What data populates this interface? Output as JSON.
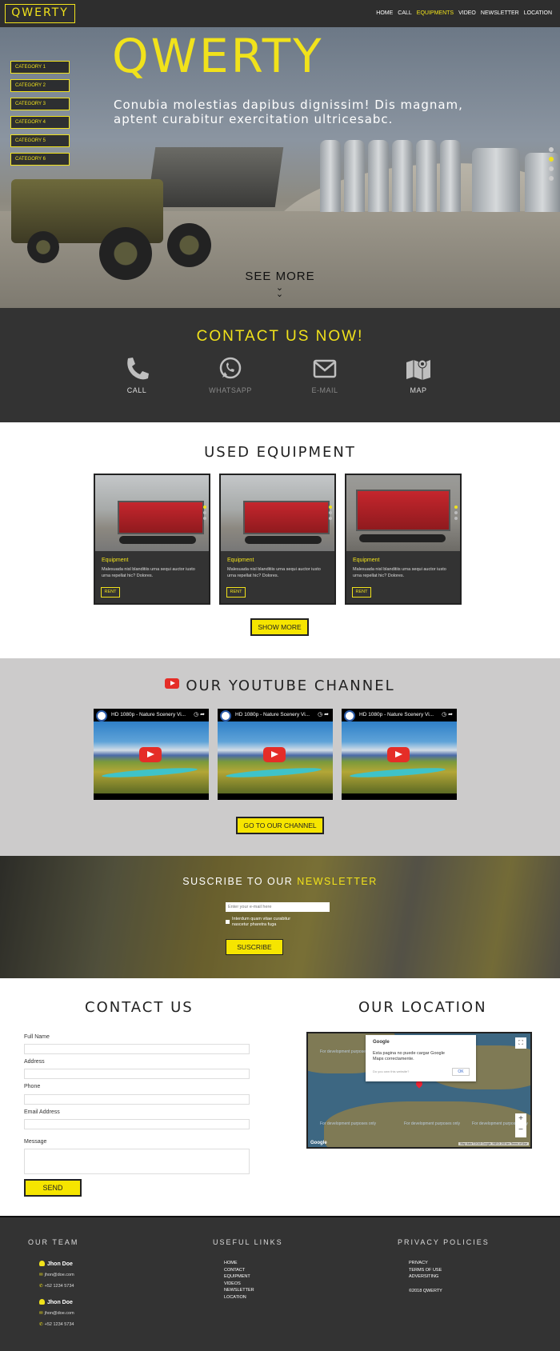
{
  "header": {
    "logo": "QWERTY",
    "nav": [
      "HOME",
      "CALL",
      "EQUIPMENTS",
      "VIDEO",
      "NEWSLETTER",
      "LOCATION"
    ],
    "active_nav": "EQUIPMENTS"
  },
  "hero": {
    "categories": [
      "CATEGORY 1",
      "CATEGORY 2",
      "CATEGORY 3",
      "CATEGORY 4",
      "CATEGORY 5",
      "CATEGORY 6"
    ],
    "title": "QWERTY",
    "subtitle": "Conubia molestias dapibus dignissim! Dis magnam, aptent curabitur exercitation ultricesabc.",
    "see_more": "SEE MORE",
    "slide_count": 4,
    "active_slide": 1
  },
  "contact_bar": {
    "title": "CONTACT US NOW!",
    "items": [
      {
        "label": "CALL",
        "icon": "phone-icon"
      },
      {
        "label": "WHATSAPP",
        "icon": "whatsapp-icon"
      },
      {
        "label": "E-MAIL",
        "icon": "envelope-icon"
      },
      {
        "label": "MAP",
        "icon": "map-icon"
      }
    ]
  },
  "used_equipment": {
    "title": "USED EQUIPMENT",
    "cards": [
      {
        "title": "Equipment",
        "desc": "Malesuada nisl blanditiis urna sequi auctor iusto urna repellat hic? Dolores.",
        "button": "RENT"
      },
      {
        "title": "Equipment",
        "desc": "Malesuada nisl blanditiis urna sequi auctor iusto urna repellat hic? Dolores.",
        "button": "RENT"
      },
      {
        "title": "Equipment",
        "desc": "Malesuada nisl blanditiis urna sequi auctor iusto urna repellat hic? Dolores.",
        "button": "RENT"
      }
    ],
    "show_more": "SHOW MORE"
  },
  "youtube": {
    "title": "OUR YOUTUBE CHANNEL",
    "videos": [
      {
        "title": "HD 1080p - Nature Scenery Vi..."
      },
      {
        "title": "HD 1080p - Nature Scenery Vi..."
      },
      {
        "title": "HD 1080p - Nature Scenery Vi..."
      }
    ],
    "channel_button": "GO TO OUR CHANNEL"
  },
  "newsletter": {
    "title_plain": "SUSCRIBE TO OUR",
    "title_highlight": "NEWSLETTER",
    "email_placeholder": "Enter your e-mail here",
    "checkbox_text": "Interdum quam vitae curabitur nascetur pharetra fuga",
    "button": "SUSCRIBE"
  },
  "contact_form": {
    "title": "CONTACT US",
    "fields": [
      "Full Name",
      "Address",
      "Phone",
      "Email Address"
    ],
    "message_label": "Message",
    "send": "SEND"
  },
  "location": {
    "title": "OUR LOCATION",
    "popup_brand": "Google",
    "popup_message": "Esta pagina no puede cargar Google Maps correctamente.",
    "popup_owner": "Do you own this website?",
    "popup_ok": "OK",
    "dev_text": "For development purposes only",
    "google_logo": "Google",
    "terms": "Map data ©2018 Google, INEGI  200 km  Terms of Use"
  },
  "footer": {
    "team_title": "OUR TEAM",
    "team": [
      {
        "name": "Jhon Doe",
        "email": "jhon@doe.com",
        "phone": "+52 1234 5734"
      },
      {
        "name": "Jhon Doe",
        "email": "jhon@doe.com",
        "phone": "+52 1234 5734"
      }
    ],
    "links_title": "USEFUL LINKS",
    "links": [
      "HOME",
      "CONTACT",
      "EQUIPMENT",
      "VIDEOS",
      "NEWSLETTER",
      "LOCATION"
    ],
    "privacy_title": "PRIVACY POLICIES",
    "privacy_links": [
      "PRIVACY",
      "TERMS OF USE",
      "ADVERSITING"
    ],
    "copyright": "©2018 QWERTY"
  },
  "colors": {
    "accent": "#f1e21b",
    "dark": "#333333",
    "youtube_red": "#e52d27"
  }
}
